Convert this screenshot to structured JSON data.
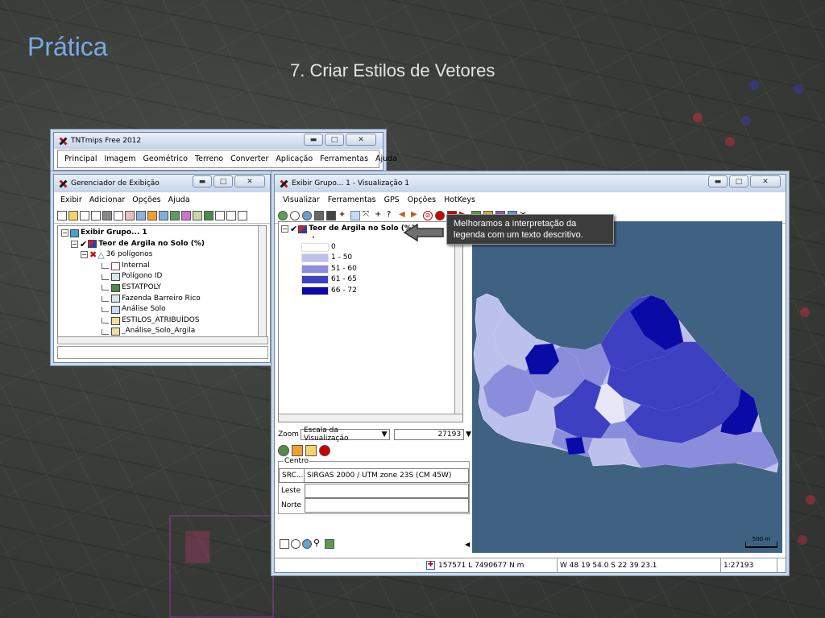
{
  "slide": {
    "title": "Prática",
    "subtitle": "7. Criar Estilos de Vetores"
  },
  "colors": {
    "accent": "#79a9e8",
    "map_bg": "#3f6283",
    "legend_0": "#ffffff",
    "legend_1": "#bcc0ec",
    "legend_2": "#8a8cdc",
    "legend_3": "#3d40c0",
    "legend_4": "#0a0aa6"
  },
  "main_window": {
    "title": "TNTmips Free 2012",
    "menu": [
      "Principal",
      "Imagem",
      "Geométrico",
      "Terreno",
      "Converter",
      "Aplicação",
      "Ferramentas",
      "Ajuda"
    ]
  },
  "display_manager": {
    "title": "Gerenciador de Exibição",
    "menu": [
      "Exibir",
      "Adicionar",
      "Opções",
      "Ajuda"
    ],
    "tree": [
      {
        "label": "Exibir Grupo... 1",
        "icon": "group-icon"
      },
      {
        "label": "Teor de Argila no Solo (%)",
        "icon": "layer-icon"
      },
      {
        "label": "36 polígonos",
        "icon": "polygon-icon"
      },
      {
        "label": "Internal",
        "icon": "table-icon"
      },
      {
        "label": "Polígono ID",
        "icon": "table-icon"
      },
      {
        "label": "ESTATPOLY",
        "icon": "table-icon"
      },
      {
        "label": "Fazenda Barreiro Rico",
        "icon": "table-icon"
      },
      {
        "label": "Análise Solo",
        "icon": "table-icon"
      },
      {
        "label": "ESTILOS_ATRIBUÍDOS",
        "icon": "style-table-icon"
      },
      {
        "label": "_Análise_Solo_Argila",
        "icon": "style-table-icon"
      }
    ]
  },
  "view_window": {
    "title": "Exibir Grupo... 1 - Visualização 1",
    "menu": [
      "Visualizar",
      "Ferramentas",
      "GPS",
      "Opções",
      "HotKeys"
    ],
    "layer_title": "Teor de Argila no Solo (%)",
    "legend": [
      "0",
      "1 - 50",
      "51 - 60",
      "61 - 65",
      "66 - 72"
    ],
    "zoom_label": "Zoom",
    "zoom_mode": "Escala da Visualização",
    "zoom_value": "27193",
    "centro_label": "Centro",
    "src_label": "SRC...",
    "src_value": "SIRGAS 2000 / UTM zone 23S (CM 45W)",
    "leste_label": "Leste",
    "norte_label": "Norte",
    "scalebar": "500 m",
    "status": {
      "coords": "157571 L 7490677 N m",
      "geo": "W 48 19 54.0  S 22 39 23.1",
      "scale": "1:27193"
    }
  },
  "callout": {
    "text": "Melhoramos a interpretação da legenda com um texto descritivo."
  }
}
